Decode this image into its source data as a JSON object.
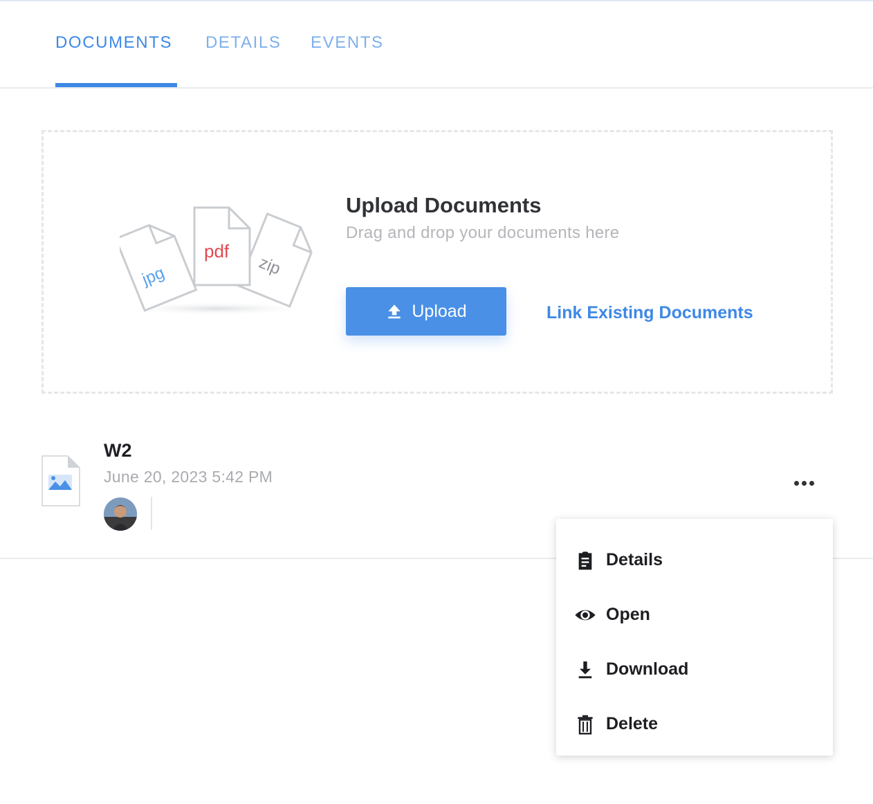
{
  "tabs": [
    {
      "label": "DOCUMENTS",
      "active": true
    },
    {
      "label": "DETAILS",
      "active": false
    },
    {
      "label": "EVENTS",
      "active": false
    }
  ],
  "upload": {
    "title": "Upload Documents",
    "subtitle": "Drag and drop your documents here",
    "button_label": "Upload",
    "link_label": "Link Existing Documents",
    "illustration_labels": [
      "jpg",
      "pdf",
      "zip"
    ]
  },
  "document": {
    "name": "W2",
    "date": "June 20, 2023 5:42 PM"
  },
  "menu": {
    "items": [
      {
        "label": "Details",
        "icon": "clipboard-icon"
      },
      {
        "label": "Open",
        "icon": "eye-icon"
      },
      {
        "label": "Download",
        "icon": "download-icon"
      },
      {
        "label": "Delete",
        "icon": "trash-icon"
      }
    ]
  },
  "colors": {
    "accent": "#3e88e5",
    "button": "#4a90e6",
    "pdf": "#e0484f"
  }
}
